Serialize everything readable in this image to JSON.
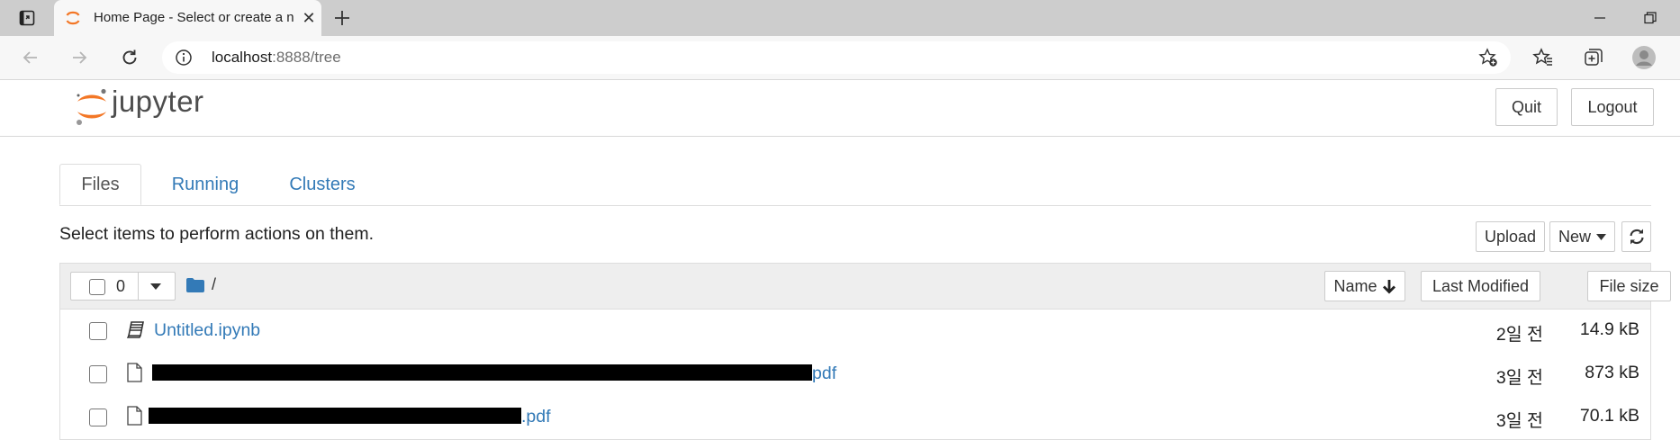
{
  "browser": {
    "tab_title": "Home Page - Select or create a n",
    "url_host": "localhost",
    "url_rest": ":8888/tree"
  },
  "header": {
    "logo_text": "jupyter",
    "quit_label": "Quit",
    "logout_label": "Logout"
  },
  "tabs": [
    {
      "label": "Files"
    },
    {
      "label": "Running"
    },
    {
      "label": "Clusters"
    }
  ],
  "toolbar": {
    "instructions": "Select items to perform actions on them.",
    "upload_label": "Upload",
    "new_label": "New"
  },
  "list_header": {
    "selected_count": "0",
    "breadcrumb": "/",
    "sort_name_label": "Name",
    "last_modified_label": "Last Modified",
    "file_size_label": "File size"
  },
  "files": [
    {
      "name": "Untitled.ipynb",
      "suffix": "",
      "type": "notebook",
      "redacted": false,
      "modified": "2일 전",
      "size": "14.9 kB"
    },
    {
      "name": "",
      "suffix": "pdf",
      "type": "file",
      "redacted": true,
      "modified": "3일 전",
      "size": "873 kB"
    },
    {
      "name": "",
      "suffix": ".pdf",
      "type": "file",
      "redacted": true,
      "modified": "3일 전",
      "size": "70.1 kB"
    }
  ],
  "colors": {
    "link": "#337ab7",
    "jupyter_orange": "#f37726",
    "tabstrip": "#cdcdcd"
  }
}
